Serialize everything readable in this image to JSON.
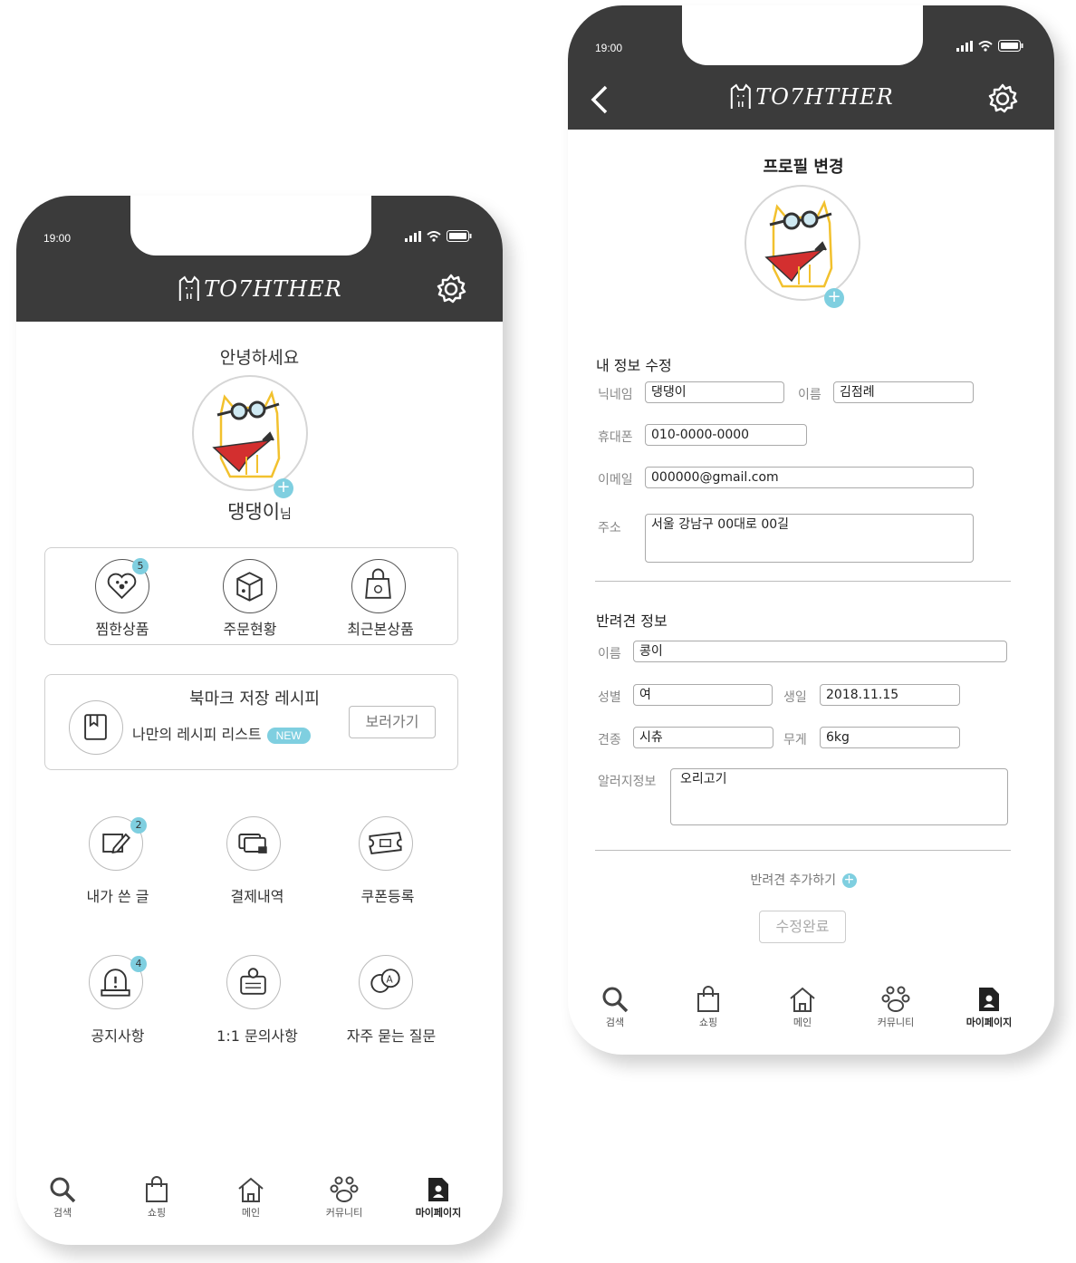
{
  "status_time": "19:00",
  "logo_text": "TO7HTHER",
  "left": {
    "greeting": "안녕하세요",
    "nickname": "댕댕이",
    "nickname_suffix": "님",
    "quick": [
      {
        "label": "찜한상품",
        "badge": "5",
        "icon": "heart-paw-icon"
      },
      {
        "label": "주문현황",
        "icon": "box-icon"
      },
      {
        "label": "최근본상품",
        "icon": "shopping-bag-icon"
      }
    ],
    "bookmark": {
      "title": "북마크 저장 레시피",
      "subtitle": "나만의 레시피 리스트",
      "new_badge": "NEW",
      "button": "보러가기"
    },
    "menu": [
      {
        "label": "내가 쓴 글",
        "badge": "2",
        "icon": "pencil-note-icon"
      },
      {
        "label": "결제내역",
        "icon": "cards-lock-icon"
      },
      {
        "label": "쿠폰등록",
        "icon": "ticket-icon"
      },
      {
        "label": "공지사항",
        "badge": "4",
        "icon": "notice-icon"
      },
      {
        "label": "1:1 문의사항",
        "icon": "inquiry-icon"
      },
      {
        "label": "자주 묻는 질문",
        "icon": "faq-icon"
      }
    ]
  },
  "right": {
    "page_title": "프로필 변경",
    "my_info_title": "내 정보 수정",
    "fields": {
      "nickname_label": "닉네임",
      "nickname_value": "댕댕이",
      "name_label": "이름",
      "name_value": "김점례",
      "phone_label": "휴대폰",
      "phone_value": "010-0000-0000",
      "email_label": "이메일",
      "email_value": "000000@gmail.com",
      "address_label": "주소",
      "address_value": "서울 강남구 00대로 00길"
    },
    "pet_title": "반려견 정보",
    "pet": {
      "name_label": "이름",
      "name_value": "콩이",
      "gender_label": "성별",
      "gender_value": "여",
      "birth_label": "생일",
      "birth_value": "2018.11.15",
      "breed_label": "견종",
      "breed_value": "시츄",
      "weight_label": "무게",
      "weight_value": "6kg",
      "allergy_label": "알러지정보",
      "allergy_value": "오리고기"
    },
    "add_pet": "반려견 추가하기",
    "submit": "수정완료"
  },
  "tabs": [
    {
      "label": "검색",
      "icon": "search-icon"
    },
    {
      "label": "쇼핑",
      "icon": "shopping-bag-icon"
    },
    {
      "label": "메인",
      "icon": "home-icon"
    },
    {
      "label": "커뮤니티",
      "icon": "paw-icon"
    },
    {
      "label": "마이페이지",
      "icon": "profile-icon"
    }
  ],
  "colors": {
    "header": "#3b3b3b",
    "accent": "#7fcfe0"
  }
}
